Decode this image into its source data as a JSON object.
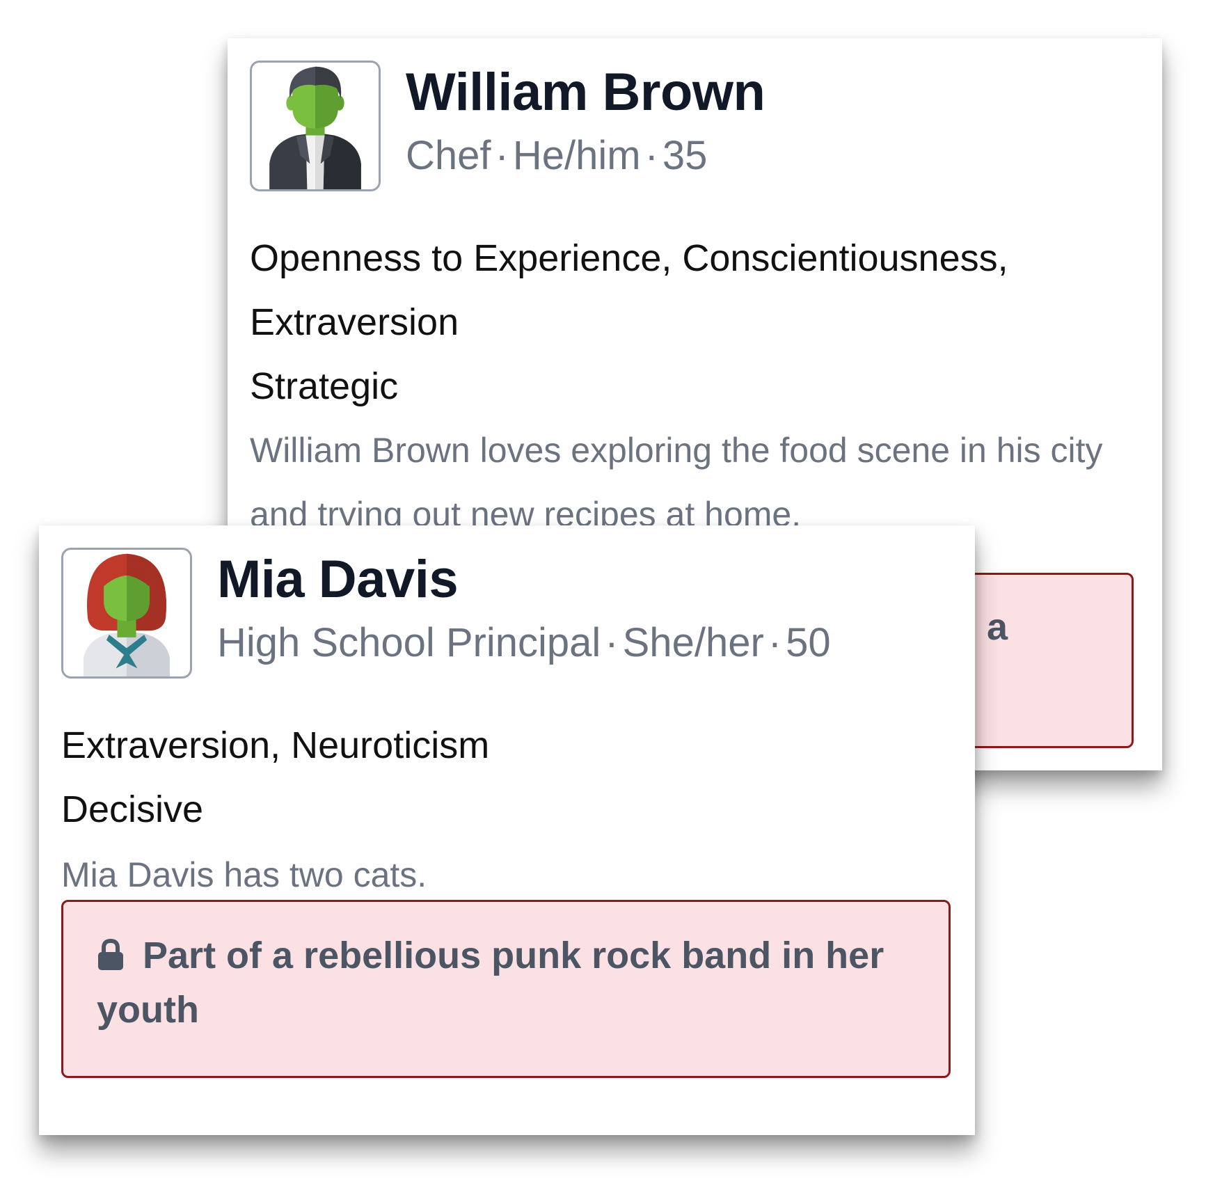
{
  "colors": {
    "name_text": "#111827",
    "muted_text": "#6b7280",
    "secret_bg": "#fce1e4",
    "secret_border": "#8b1a1a",
    "avatar_skin": "#7abf3f",
    "avatar_hair_william": "#4b4e58",
    "avatar_hair_mia": "#c0392b"
  },
  "cards": {
    "william": {
      "avatar_icon": "man-in-suit-avatar",
      "name": "William Brown",
      "occupation": "Chef",
      "pronouns": "He/him",
      "age": "35",
      "separator": "·",
      "traits": "Openness to Experience, Conscientiousness, Extraversion",
      "style": "Strategic",
      "bio": "William Brown loves exploring the food scene in his city and trying out new recipes at home.",
      "secret_partial": "n a"
    },
    "mia": {
      "avatar_icon": "woman-red-hair-avatar",
      "name": "Mia Davis",
      "occupation": "High School Principal",
      "pronouns": "She/her",
      "age": "50",
      "separator": "·",
      "traits": "Extraversion, Neuroticism",
      "style": "Decisive",
      "bio": "Mia Davis has two cats.",
      "secret_icon": "lock-icon",
      "secret": "Part of a rebellious punk rock band in her youth"
    }
  }
}
